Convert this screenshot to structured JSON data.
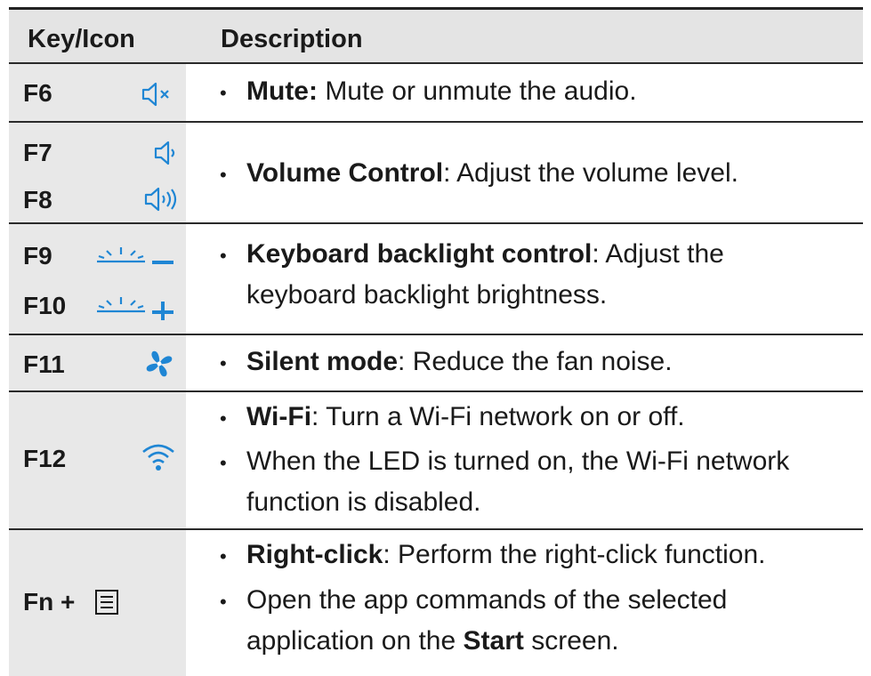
{
  "header": {
    "key_col": "Key/Icon",
    "desc_col": "Description"
  },
  "rows": {
    "f6": {
      "key": "F6",
      "icon": "speaker-mute-icon",
      "b1": {
        "bold": "Mute:",
        "text": " Mute or unmute the audio."
      }
    },
    "f7f8": {
      "key1": "F7",
      "icon1": "speaker-volume-down-icon",
      "key2": "F8",
      "icon2": "speaker-volume-up-icon",
      "b1": {
        "bold": "Volume Control",
        "text": ": Adjust the volume level."
      }
    },
    "f9f10": {
      "key1": "F9",
      "icon1": "backlight-decrease-icon",
      "key2": "F10",
      "icon2": "backlight-increase-icon",
      "b1": {
        "bold": "Keyboard backlight control",
        "text": ": Adjust the",
        "text2": "keyboard backlight brightness."
      }
    },
    "f11": {
      "key": "F11",
      "icon": "fan-icon",
      "b1": {
        "bold": "Silent mode",
        "text": ": Reduce the fan noise."
      }
    },
    "f12": {
      "key": "F12",
      "icon": "wifi-icon",
      "b1": {
        "bold": "Wi-Fi",
        "text": ": Turn a Wi-Fi network on or off."
      },
      "b2": {
        "line1": "When the LED is turned on, the Wi-Fi network",
        "line2": "function is disabled."
      }
    },
    "fn": {
      "key": "Fn +",
      "icon": "menu-key-icon",
      "b1": {
        "bold": "Right-click",
        "text": ": Perform the right-click function."
      },
      "b2": {
        "line1": "Open the app commands of the selected",
        "line2_pre": "application on the ",
        "line2_bold": "Start",
        "line2_post": " screen."
      }
    }
  },
  "bullet": "•",
  "colors": {
    "icon": "#1f86d4",
    "key_bg": "#e8e8e8",
    "header_bg": "#e4e4e4"
  }
}
